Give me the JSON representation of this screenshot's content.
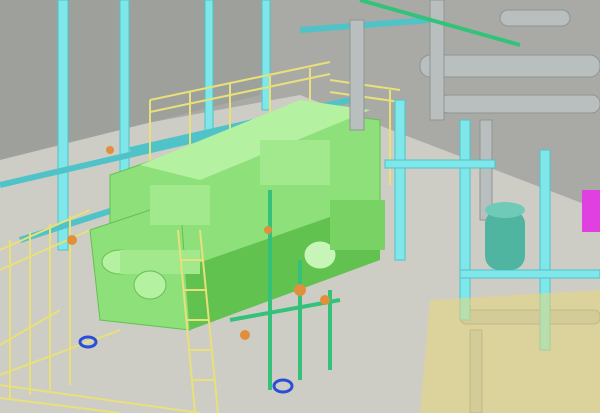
{
  "scene": {
    "palette": {
      "floor": "#cdcdc6",
      "wall": "#a9aaa6",
      "wall_dark": "#8f918d",
      "steel": "#7fe6ea",
      "steel_dark": "#4fc3c8",
      "equipment": "#8ee07a",
      "equipment_dark": "#62c24f",
      "equipment_light": "#b4f2a2",
      "railing": "#e8e07a",
      "pipe_grey": "#b9bfbe",
      "pipe_grey_dark": "#8e9593",
      "pipe_green": "#34c27a",
      "valve_orange": "#e0903c",
      "valve_blue": "#2a4fd6",
      "accent_magenta": "#e040e0",
      "tank_teal": "#4fb4a0",
      "platform_yellow": "#e9d77a"
    }
  }
}
